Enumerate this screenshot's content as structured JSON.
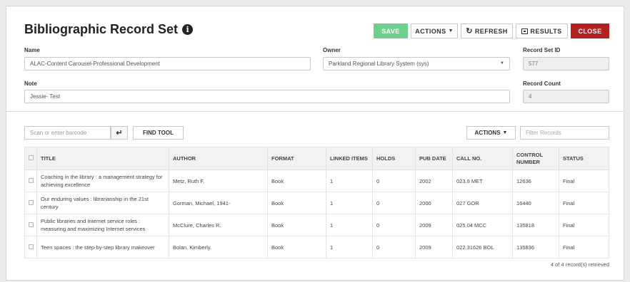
{
  "header": {
    "title": "Bibliographic Record Set",
    "info_glyph": "i",
    "buttons": {
      "save": "SAVE",
      "actions": "ACTIONS",
      "refresh": "REFRESH",
      "results": "RESULTS",
      "close": "CLOSE"
    }
  },
  "form": {
    "name_label": "Name",
    "name_value": "ALAC-Content Carousel-Professional Development",
    "owner_label": "Owner",
    "owner_value": "Parkland Regional Library System (sys)",
    "record_set_id_label": "Record Set ID",
    "record_set_id_value": "577",
    "note_label": "Note",
    "note_value": "Jessie- Test",
    "record_count_label": "Record Count",
    "record_count_value": "4"
  },
  "toolbar": {
    "barcode_placeholder": "Scan or enter barcode",
    "find_tool": "FIND TOOL",
    "actions": "ACTIONS",
    "filter_placeholder": "Filter Records"
  },
  "table": {
    "headers": {
      "title": "TITLE",
      "author": "AUTHOR",
      "format": "FORMAT",
      "linked_items": "LINKED ITEMS",
      "holds": "HOLDS",
      "pub_date": "PUB DATE",
      "call_no": "CALL NO.",
      "control_number": "CONTROL NUMBER",
      "status": "STATUS"
    },
    "rows": [
      {
        "title": "Coaching in the library : a management strategy for achieving excellence",
        "author": "Metz, Ruth F.",
        "format": "Book",
        "linked_items": "1",
        "holds": "0",
        "pub_date": "2002",
        "call_no": "023.9 MET",
        "control_number": "12636",
        "status": "Final"
      },
      {
        "title": "Our enduring values : librarianship in the 21st century",
        "author": "Gorman, Michael, 1941-",
        "format": "Book",
        "linked_items": "1",
        "holds": "0",
        "pub_date": "2000",
        "call_no": "027 GOR",
        "control_number": "16440",
        "status": "Final"
      },
      {
        "title": "Public libraries and Internet service roles : measuring and maximizing Internet services",
        "author": "McClure, Charles R.",
        "format": "Book",
        "linked_items": "1",
        "holds": "0",
        "pub_date": "2009",
        "call_no": "025.04 MCC",
        "control_number": "135818",
        "status": "Final"
      },
      {
        "title": "Teen spaces : the step-by-step library makeover",
        "author": "Bolan, Kimberly.",
        "format": "Book",
        "linked_items": "1",
        "holds": "0",
        "pub_date": "2009",
        "call_no": "022.31626 BOL",
        "control_number": "135836",
        "status": "Final"
      }
    ]
  },
  "footer": {
    "status": "4 of 4 record(s) retrieved"
  },
  "colors": {
    "save": "#6fcf8c",
    "close": "#b22222"
  }
}
